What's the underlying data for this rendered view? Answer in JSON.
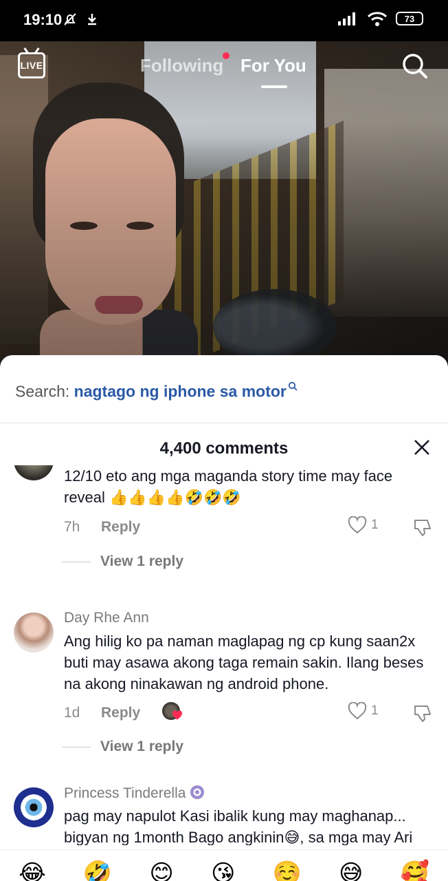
{
  "status_bar": {
    "time": "19:10",
    "battery": "73",
    "left_icons": [
      "bell-off-icon",
      "download-icon"
    ],
    "right_icons": [
      "signal-icon",
      "wifi-icon",
      "battery-icon"
    ]
  },
  "top_nav": {
    "live_label": "LIVE",
    "tabs": [
      {
        "label": "Following",
        "active": false
      },
      {
        "label": "For You",
        "active": true
      }
    ]
  },
  "comments_panel": {
    "search_prefix": "Search:",
    "search_query": "nagtago ng iphone sa motor",
    "count_label": "4,400 comments",
    "comments": [
      {
        "username": "",
        "text": "12/10 eto ang mga maganda story time may face reveal 👍👍👍👍🤣🤣🤣",
        "time": "7h",
        "reply_label": "Reply",
        "likes": "1",
        "view_replies": "View 1 reply"
      },
      {
        "username": "Day Rhe Ann",
        "text": "Ang hilig ko pa naman maglapag ng cp kung saan2x buti may asawa akong taga remain sakin. Ilang beses na akong ninakawan ng android phone.",
        "time": "1d",
        "reply_label": "Reply",
        "likes": "1",
        "view_replies": "View 1 reply"
      },
      {
        "username": "Princess Tinderella",
        "text": "pag may napulot Kasi ibalik kung may maghanap... bigyan ng 1month Bago angkinin😅, sa mga may Ari Naman bigyan reward Ang nakapulot kahit pang SB"
      }
    ]
  },
  "emoji_bar": [
    "😂",
    "🤣",
    "😊",
    "😘",
    "☺️",
    "😅",
    "🥰"
  ],
  "colors": {
    "accent_red": "#fe2c55",
    "link_blue": "#2b5aa6",
    "text_dark": "#161823",
    "text_gray": "#8a8a8a"
  }
}
